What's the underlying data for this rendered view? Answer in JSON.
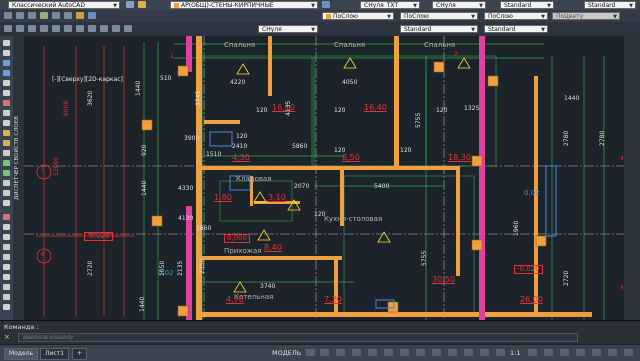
{
  "toolbar": {
    "workspace": "Классический AutoCAD",
    "layer": "АР(ОБЩ)-СТЕНЫ-КИРПИЧНЫЕ",
    "text_style_1": "СНуля_TXT",
    "dim_style": "СНуля",
    "table_style": "Standard",
    "mleader_style": "Standard",
    "color_1": "ПоСлою",
    "linetype_1": "ПоСлою",
    "lineweight": "ПоСлою",
    "plotstyle": "ПоЦвету",
    "dim_style_2": "СНуля",
    "style_3": "Standard",
    "style_4": "Standard"
  },
  "canvas": {
    "viewport_label": "[-][Сверху][2D-каркас]",
    "palette_label": "ДИСПЕТЧЕР СВОЙСТВ СЛОЕВ",
    "rooms": [
      "Спальня",
      "Спальня",
      "Спальня",
      "Кладовая",
      "Кухня-столовая",
      "Прихожая",
      "Котельная"
    ],
    "room_areas": [
      "16,10",
      "16,40",
      "4,30",
      "8,50",
      "18,30",
      "1,80",
      "3,10",
      "8,40",
      "30,50",
      "4,70",
      "7,20",
      "26,00"
    ],
    "levels": [
      "-0,020",
      "0,000",
      "0,02",
      "-0,020",
      "0,02"
    ],
    "dims_top": [
      "4220",
      "4050",
      "3745",
      "4135",
      "5755",
      "5755",
      "1325"
    ],
    "dims_mid": [
      "2410",
      "5860",
      "2070",
      "5400",
      "3740",
      "2350",
      "1960",
      "2780",
      "2720",
      "2780"
    ],
    "dims_left": [
      "6000",
      "12000",
      "3620",
      "1440",
      "920",
      "1440",
      "2720",
      "2135",
      "1440",
      "1050"
    ],
    "small_dims": [
      "510",
      "120",
      "120",
      "120",
      "120",
      "120",
      "120",
      "120",
      "1440",
      "3900",
      "4330",
      "4130",
      "1510",
      "1860"
    ],
    "axis_marks": [
      "5",
      "6",
      "1",
      "2",
      "4",
      "3"
    ]
  },
  "command": {
    "label": "Команда :",
    "placeholder": "Введите команду",
    "close": "×"
  },
  "status": {
    "tabs": [
      "Модель",
      "Лист1",
      "+"
    ],
    "model": "МОДЕЛЬ",
    "scale": "1:1"
  },
  "colors": {
    "wall": "#f0a040",
    "wall_pink": "#e040a0",
    "dim_green": "#2aa84a",
    "dim_red": "#e83030",
    "grid_white": "#c8c8c8",
    "yellow_text": "#ffe020"
  }
}
